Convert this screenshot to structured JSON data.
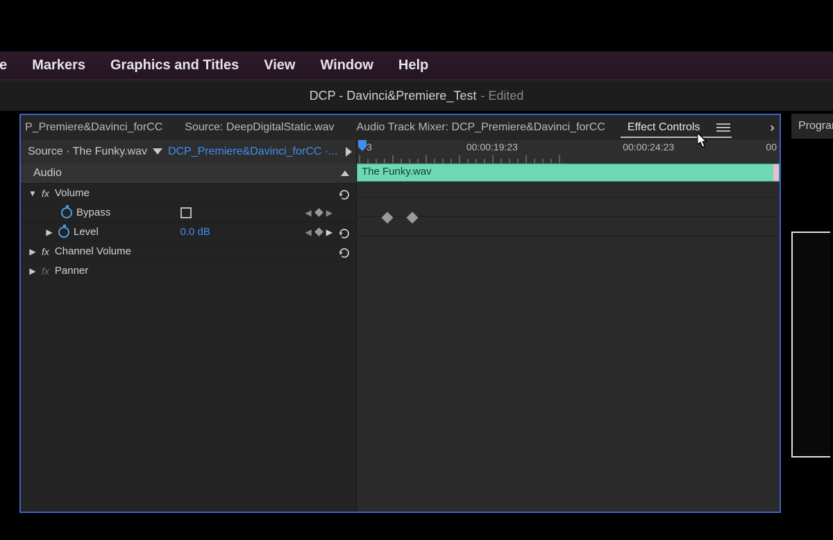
{
  "menu": [
    "ce",
    "Markers",
    "Graphics and Titles",
    "View",
    "Window",
    "Help"
  ],
  "title": {
    "name": "DCP - Davinci&Premiere_Test",
    "suffix": "- Edited"
  },
  "tabs": {
    "t0": "P_Premiere&Davinci_forCC",
    "t1": "Source: DeepDigitalStatic.wav",
    "t2": "Audio Track Mixer: DCP_Premiere&Davinci_forCC",
    "t3": "Effect Controls",
    "outside": "Program"
  },
  "source": {
    "label": "Source",
    "clip": "The Funky.wav",
    "seq": "DCP_Premiere&Davinci_forCC ·..."
  },
  "section": "Audio",
  "effects": {
    "volume": "Volume",
    "bypass": "Bypass",
    "level": "Level",
    "level_val": "0.0 dB",
    "channel": "Channel Volume",
    "panner": "Panner"
  },
  "timeline": {
    "tc0": "3",
    "tc1": "00:00:19:23",
    "tc2": "00:00:24:23",
    "tc3": "00",
    "clip": "The Funky.wav"
  }
}
